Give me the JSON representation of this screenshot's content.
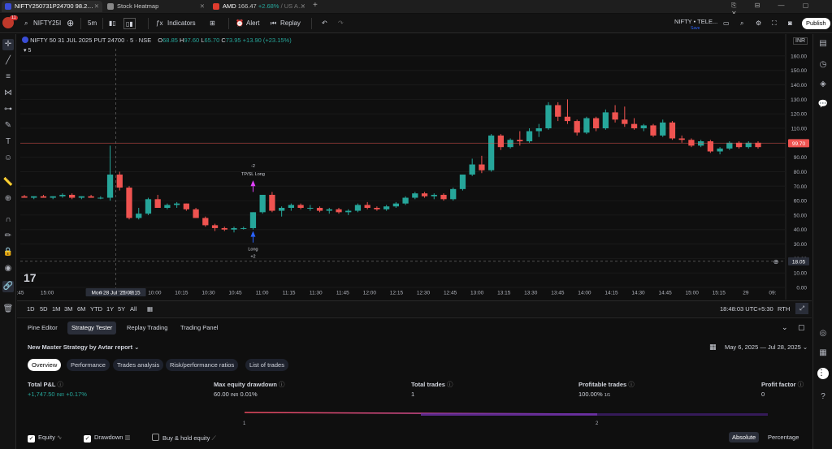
{
  "tabs": [
    {
      "label": "NIFTY250731P24700",
      "suffix": "98.2…",
      "active": true,
      "icon_color": "#3a4dd6"
    },
    {
      "label": "Stock Heatmap",
      "active": false,
      "icon_color": "#888888"
    },
    {
      "label": "AMD",
      "price": "166.47",
      "change": "+2.68%",
      "extra": "/ US A…",
      "active": false,
      "icon_color": "#e03c2e"
    }
  ],
  "toolbar": {
    "symbol": "NIFTY25I",
    "interval": "5m",
    "indicators": "Indicators",
    "alert": "Alert",
    "replay": "Replay",
    "layout_name": "NIFTY • TELE...",
    "layout_sub": "Save",
    "publish": "Publish",
    "avatar_badge": "11"
  },
  "legend": {
    "title": "NIFTY 50 31 JUL 2025 PUT 24700 · 5 · NSE",
    "o_label": "O",
    "o": "68.85",
    "h_label": "H",
    "h": "97.60",
    "l_label": "L",
    "l": "65.70",
    "c_label": "C",
    "c": "73.95",
    "change": "+13.90 (+23.15%)",
    "interval_badge": "5",
    "currency": "INR"
  },
  "axis": {
    "y_ticks": [
      "160.00",
      "150.00",
      "140.00",
      "130.00",
      "120.00",
      "110.00",
      "100.00",
      "90.00",
      "80.00",
      "70.00",
      "60.00",
      "50.00",
      "40.00",
      "30.00",
      "20.00",
      "10.00",
      "0.00"
    ],
    "x_ticks": [
      ":45",
      "15:00",
      "Mon 28 Jul '25  09:15",
      "0",
      "09:45",
      "10:00",
      "10:15",
      "10:30",
      "10:45",
      "11:00",
      "11:15",
      "11:30",
      "11:45",
      "12:00",
      "12:15",
      "12:30",
      "12:45",
      "13:00",
      "13:15",
      "13:30",
      "13:45",
      "14:00",
      "14:15",
      "14:30",
      "14:45",
      "15:00",
      "15:15",
      "29",
      "09:"
    ],
    "price_tag": "99.70",
    "cross_tag": "18.05"
  },
  "annotations": {
    "tp_sl_qty": "-2",
    "tp_sl": "TP/SL Long",
    "long": "Long",
    "long_qty": "+2"
  },
  "chart_data": {
    "type": "candlestick",
    "ylim": [
      0,
      165
    ],
    "colors": {
      "up": "#26a69a",
      "down": "#ef5350"
    },
    "candles": [
      [
        63,
        64,
        62,
        62
      ],
      [
        62,
        63,
        61,
        63
      ],
      [
        63,
        64,
        62,
        62
      ],
      [
        62,
        63,
        61,
        63
      ],
      [
        63,
        65,
        62,
        64
      ],
      [
        64,
        65,
        61,
        62
      ],
      [
        62,
        63,
        61,
        63
      ],
      [
        63,
        64,
        62,
        62
      ],
      [
        62,
        63,
        61,
        62
      ],
      [
        62,
        98,
        60,
        78
      ],
      [
        78,
        80,
        67,
        69
      ],
      [
        69,
        70,
        47,
        48
      ],
      [
        48,
        55,
        47,
        51
      ],
      [
        51,
        62,
        50,
        61
      ],
      [
        61,
        64,
        55,
        55
      ],
      [
        55,
        58,
        54,
        57
      ],
      [
        57,
        59,
        55,
        58
      ],
      [
        58,
        58,
        53,
        54
      ],
      [
        54,
        55,
        48,
        48
      ],
      [
        48,
        49,
        42,
        43
      ],
      [
        43,
        44,
        39,
        41
      ],
      [
        41,
        42,
        39,
        40
      ],
      [
        40,
        42,
        38,
        41
      ],
      [
        41,
        42,
        40,
        41
      ],
      [
        41,
        52,
        40,
        52
      ],
      [
        52,
        63,
        51,
        64
      ],
      [
        64,
        66,
        52,
        53
      ],
      [
        53,
        56,
        49,
        55
      ],
      [
        55,
        58,
        53,
        57
      ],
      [
        57,
        58,
        54,
        55
      ],
      [
        55,
        57,
        53,
        55
      ],
      [
        55,
        56,
        52,
        53
      ],
      [
        53,
        55,
        51,
        54
      ],
      [
        54,
        55,
        51,
        52
      ],
      [
        52,
        54,
        50,
        53
      ],
      [
        53,
        58,
        52,
        57
      ],
      [
        57,
        59,
        54,
        55
      ],
      [
        55,
        56,
        53,
        54
      ],
      [
        54,
        57,
        53,
        56
      ],
      [
        56,
        59,
        55,
        58
      ],
      [
        58,
        63,
        57,
        62
      ],
      [
        62,
        66,
        61,
        65
      ],
      [
        65,
        66,
        62,
        63
      ],
      [
        63,
        65,
        61,
        64
      ],
      [
        64,
        65,
        60,
        61
      ],
      [
        61,
        69,
        60,
        68
      ],
      [
        68,
        78,
        67,
        78
      ],
      [
        78,
        89,
        77,
        85
      ],
      [
        85,
        91,
        79,
        81
      ],
      [
        81,
        106,
        80,
        105
      ],
      [
        105,
        106,
        95,
        97
      ],
      [
        97,
        103,
        96,
        102
      ],
      [
        102,
        108,
        98,
        101
      ],
      [
        101,
        110,
        100,
        108
      ],
      [
        108,
        113,
        104,
        110
      ],
      [
        110,
        128,
        109,
        126
      ],
      [
        126,
        128,
        115,
        118
      ],
      [
        118,
        130,
        113,
        115
      ],
      [
        115,
        116,
        105,
        107
      ],
      [
        107,
        118,
        106,
        117
      ],
      [
        117,
        118,
        108,
        110
      ],
      [
        110,
        123,
        109,
        121
      ],
      [
        121,
        126,
        114,
        116
      ],
      [
        116,
        125,
        111,
        113
      ],
      [
        113,
        117,
        109,
        110
      ],
      [
        110,
        113,
        108,
        112
      ],
      [
        112,
        113,
        104,
        105
      ],
      [
        105,
        116,
        104,
        114
      ],
      [
        114,
        115,
        102,
        103
      ],
      [
        103,
        105,
        100,
        102
      ],
      [
        102,
        103,
        97,
        98
      ],
      [
        98,
        102,
        97,
        101
      ],
      [
        101,
        102,
        93,
        94
      ],
      [
        94,
        97,
        92,
        96
      ],
      [
        96,
        101,
        95,
        100
      ],
      [
        100,
        101,
        96,
        97
      ],
      [
        97,
        101,
        96,
        100
      ],
      [
        100,
        101,
        96,
        97
      ]
    ]
  },
  "bottom_tf": {
    "ranges": [
      "1D",
      "5D",
      "1M",
      "3M",
      "6M",
      "YTD",
      "1Y",
      "5Y",
      "All"
    ],
    "clock": "18:48:03 UTC+5:30",
    "rth": "RTH"
  },
  "panel": {
    "tabs": [
      "Pine Editor",
      "Strategy Tester",
      "Replay Trading",
      "Trading Panel"
    ],
    "strategy_name": "New Master Strategy by Avtar report",
    "date_range": "May 6, 2025 — Jul 28, 2025",
    "subtabs": [
      "Overview",
      "Performance",
      "Trades analysis",
      "Risk/performance ratios",
      "List of trades"
    ],
    "metrics": [
      {
        "label": "Total P&L",
        "value": "+1,747.50",
        "unit": "INR",
        "extra": "+0.17%",
        "color": "#26a69a"
      },
      {
        "label": "Max equity drawdown",
        "value": "60.00",
        "unit": "INR",
        "extra": "0.01%",
        "color": "#d1d4dc"
      },
      {
        "label": "Total trades",
        "value": "1",
        "unit": "",
        "extra": "",
        "color": "#d1d4dc"
      },
      {
        "label": "Profitable trades",
        "value": "100.00%",
        "unit": "",
        "extra": "1/1",
        "color": "#d1d4dc"
      },
      {
        "label": "Profit factor",
        "value": "0",
        "unit": "",
        "extra": "",
        "color": "#d1d4dc"
      }
    ],
    "equity_ticks": [
      "1",
      "2"
    ],
    "checks": [
      {
        "label": "Equity",
        "checked": true
      },
      {
        "label": "Drawdown",
        "checked": true
      },
      {
        "label": "Buy & hold equity",
        "checked": false
      }
    ],
    "toggle": [
      "Absolute",
      "Percentage"
    ]
  }
}
